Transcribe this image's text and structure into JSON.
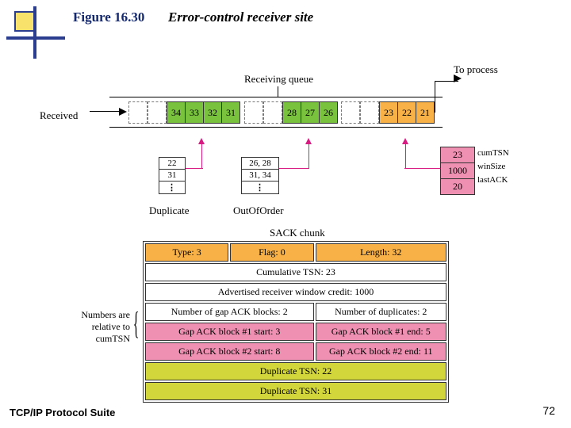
{
  "figure": {
    "label": "Figure 16.30",
    "title": "Error-control receiver site"
  },
  "footer": {
    "left": "TCP/IP Protocol Suite",
    "page": "72"
  },
  "top": {
    "received": "Received",
    "recvq": "Receiving queue",
    "toproc": "To process"
  },
  "queue": {
    "green": [
      "34",
      "33",
      "32",
      "31"
    ],
    "mid": [
      "28",
      "27",
      "26"
    ],
    "orange": [
      "23",
      "22",
      "21"
    ]
  },
  "state": {
    "cumTSN": "23",
    "winSize": "1000",
    "lastACK": "20",
    "l1": "cumTSN",
    "l2": "winSize",
    "l3": "lastACK"
  },
  "stacks": {
    "dup": {
      "vals": [
        "22",
        "31"
      ],
      "label": "Duplicate"
    },
    "ooo": {
      "vals": [
        "26, 28",
        "31, 34"
      ],
      "label": "OutOfOrder"
    }
  },
  "sack": {
    "title": "SACK chunk",
    "h": {
      "type": "Type: 3",
      "flag": "Flag: 0",
      "len": "Length: 32"
    },
    "cum": "Cumulative TSN: 23",
    "win": "Advertised receiver window credit: 1000",
    "gaps": {
      "l": "Number of gap ACK blocks: 2",
      "r": "Number of duplicates: 2"
    },
    "g1": {
      "l": "Gap ACK block #1 start: 3",
      "r": "Gap ACK block #1 end: 5"
    },
    "g2": {
      "l": "Gap ACK block #2 start: 8",
      "r": "Gap ACK block #2 end: 11"
    },
    "d1": "Duplicate TSN: 22",
    "d2": "Duplicate TSN: 31",
    "note": "Numbers are\nrelative to\ncumTSN"
  }
}
